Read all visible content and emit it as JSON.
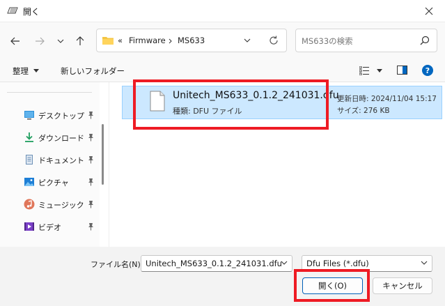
{
  "window": {
    "title": "開く"
  },
  "address": {
    "overflow": "«",
    "segments": [
      "Firmware",
      "MS633"
    ]
  },
  "search": {
    "placeholder": "MS633の検索"
  },
  "toolbar": {
    "organize": "整理",
    "new_folder": "新しいフォルダー"
  },
  "sidebar": {
    "items": [
      {
        "label": "デスクトップ",
        "icon": "desktop-icon"
      },
      {
        "label": "ダウンロード",
        "icon": "download-icon"
      },
      {
        "label": "ドキュメント",
        "icon": "document-icon"
      },
      {
        "label": "ピクチャ",
        "icon": "pictures-icon"
      },
      {
        "label": "ミュージック",
        "icon": "music-icon"
      },
      {
        "label": "ビデオ",
        "icon": "video-icon"
      }
    ]
  },
  "file": {
    "name": "Unitech_MS633_0.1.2_241031.dfu",
    "type": "種類: DFU ファイル",
    "modified": "更新日時: 2024/11/04 15:17",
    "size": "サイズ: 276 KB"
  },
  "bottom": {
    "filename_label": "ファイル名(N):",
    "filename_value": "Unitech_MS633_0.1.2_241031.dfu",
    "filetype_value": "Dfu Files (*.dfu)",
    "open_label": "開く(O)",
    "cancel_label": "キャンセル"
  },
  "colors": {
    "accent": "#005fb8",
    "selection": "#cce8ff",
    "highlight": "#ee1b24",
    "help": "#0067c0"
  }
}
